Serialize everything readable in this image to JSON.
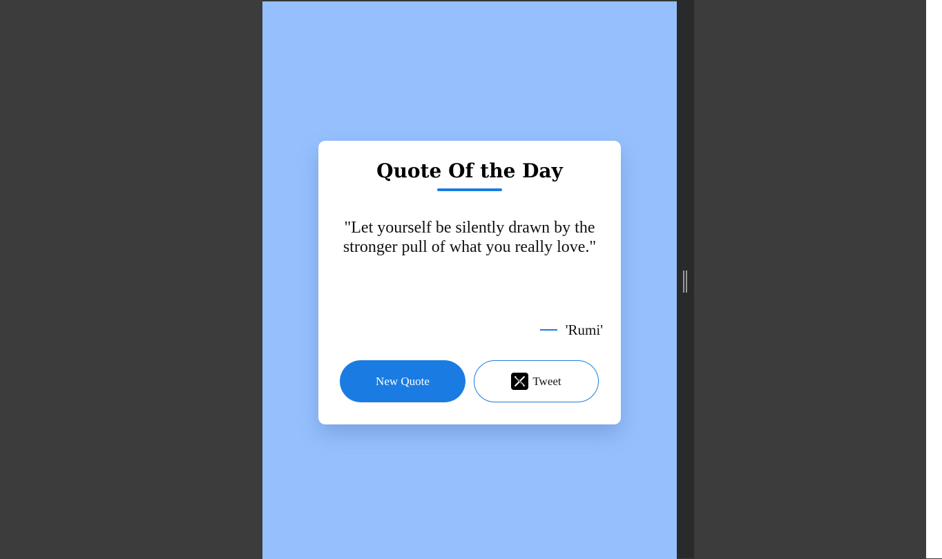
{
  "card": {
    "title": "Quote Of the Day",
    "quote": "\"Let yourself be silently drawn by the stronger pull of what you really love.\"",
    "author": "'Rumi'"
  },
  "buttons": {
    "new_quote_label": "New Quote",
    "tweet_label": "Tweet"
  },
  "icons": {
    "tweet_icon": "x-logo-icon"
  },
  "colors": {
    "background": "#96c0fd",
    "accent": "#1a7ce2",
    "card": "#ffffff"
  }
}
